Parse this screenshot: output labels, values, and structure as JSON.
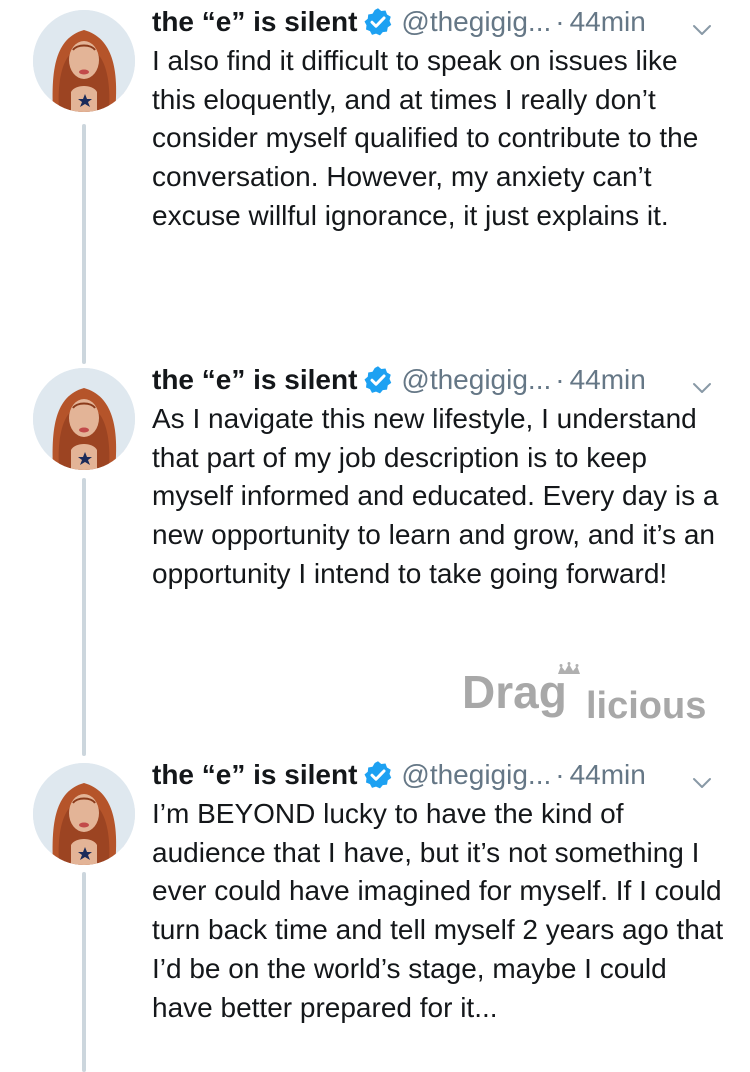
{
  "tweets": [
    {
      "display_name": "the “e” is silent",
      "handle": "@thegigig...",
      "separator": "·",
      "time": "44min",
      "text": "I also find it difficult to speak on issues like this eloquently, and at times I really don’t consider myself qualified to contribute to the conversation. However, my anxiety can’t excuse willful ignorance, it just explains it."
    },
    {
      "display_name": "the “e” is silent",
      "handle": "@thegigig...",
      "separator": "·",
      "time": "44min",
      "text": "As I navigate this new lifestyle, I understand that part of my job description is to keep myself informed and educated. Every day is a new opportunity to learn and grow, and it’s an opportunity I intend to take going forward!"
    },
    {
      "display_name": "the “e” is silent",
      "handle": "@thegigig...",
      "separator": "·",
      "time": "44min",
      "text": "I’m BEYOND lucky to have the kind of audience that I have, but it’s not something I ever could have imagined for myself. If I could turn back time and tell myself 2 years ago that I’d be on the world’s stage, maybe I could have better prepared for it..."
    }
  ],
  "watermark": {
    "text_part1": "Drag",
    "text_part2": "licious"
  },
  "icons": {
    "verified": "verified-badge-icon",
    "caret": "chevron-down-icon",
    "avatar": "profile-avatar"
  },
  "colors": {
    "verified_blue": "#1da1f2",
    "secondary_text": "#657786",
    "thread_line": "#ccd6dd",
    "watermark_gray": "#a8a8a8"
  }
}
